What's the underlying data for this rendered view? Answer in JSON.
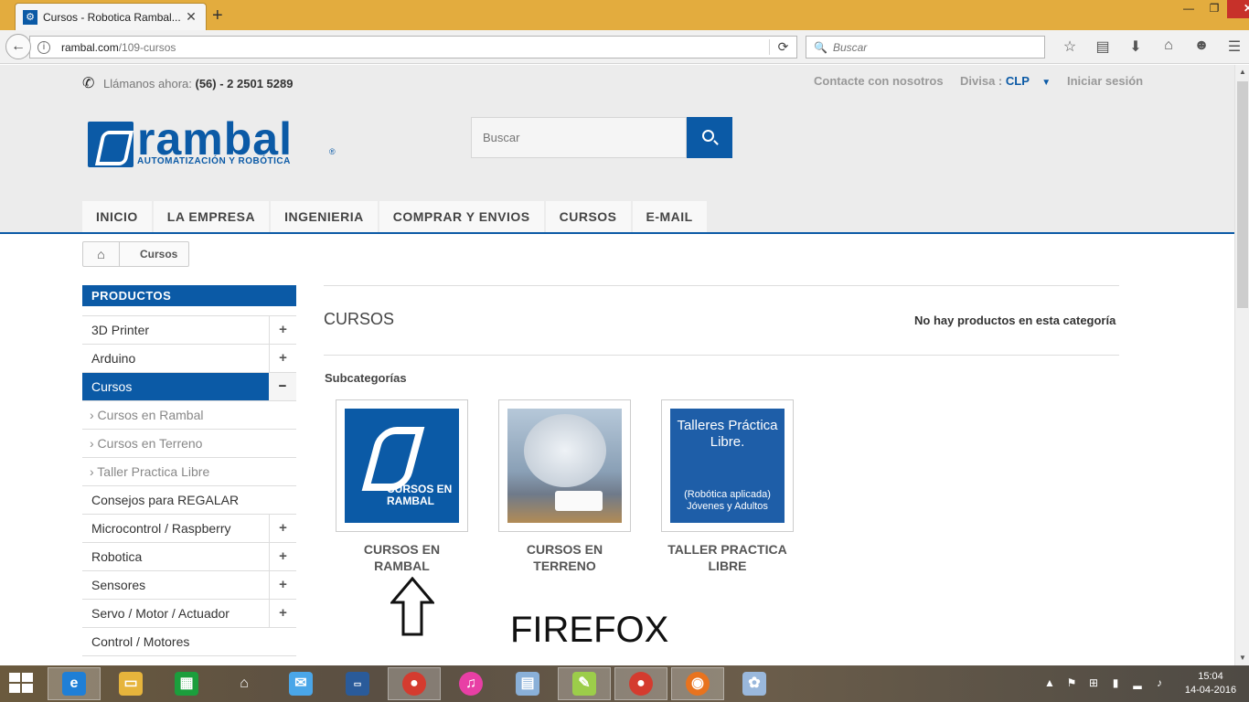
{
  "browser": {
    "tab_title": "Cursos - Robotica Rambal...",
    "tab_close": "✕",
    "new_tab": "+",
    "window_controls": {
      "minimize": "—",
      "maximize": "❐",
      "close": "✕"
    },
    "url_host": "rambal.com",
    "url_path": "/109-cursos",
    "search_placeholder": "Buscar",
    "toolbar_icons": [
      "star-icon",
      "reading-list-icon",
      "download-icon",
      "home-icon",
      "hello-icon",
      "menu-icon"
    ]
  },
  "header": {
    "call_label": "Llámanos ahora:",
    "phone": "(56) - 2 2501 5289",
    "contact_link": "Contacte con nosotros",
    "currency_label": "Divisa :",
    "currency_value": "CLP",
    "login_link": "Iniciar sesión",
    "logo_word": "rambal",
    "logo_sub": "AUTOMATIZACIÓN Y ROBÓTICA",
    "logo_reg": "®",
    "search_placeholder": "Buscar"
  },
  "menu": [
    "INICIO",
    "LA EMPRESA",
    "INGENIERIA",
    "COMPRAR Y ENVIOS",
    "CURSOS",
    "E-MAIL"
  ],
  "breadcrumb": {
    "current": "Cursos"
  },
  "sidebar": {
    "title": "PRODUCTOS",
    "items": [
      {
        "label": "3D Printer",
        "toggle": "+"
      },
      {
        "label": "Arduino",
        "toggle": "+"
      },
      {
        "label": "Cursos",
        "toggle": "−"
      },
      {
        "label": "› Cursos en Rambal",
        "toggle": ""
      },
      {
        "label": "› Cursos en Terreno",
        "toggle": ""
      },
      {
        "label": "› Taller Practica Libre",
        "toggle": ""
      },
      {
        "label": "Consejos para REGALAR",
        "toggle": ""
      },
      {
        "label": "Microcontrol / Raspberry",
        "toggle": "+"
      },
      {
        "label": "Robotica",
        "toggle": "+"
      },
      {
        "label": "Sensores",
        "toggle": "+"
      },
      {
        "label": "Servo / Motor / Actuador",
        "toggle": "+"
      },
      {
        "label": "Control / Motores",
        "toggle": ""
      }
    ]
  },
  "content": {
    "category_title": "CURSOS",
    "no_products": "No hay productos en esta categoría",
    "subcategories_label": "Subcategorías",
    "subcategories": [
      {
        "name": "CURSOS EN RAMBAL",
        "image_caption": "CURSOS EN RAMBAL"
      },
      {
        "name": "CURSOS EN TERRENO"
      },
      {
        "name": "TALLER PRACTICA LIBRE",
        "image_title": "Talleres Práctica Libre.",
        "image_sub": "(Robótica aplicada) Jóvenes y Adultos"
      }
    ],
    "annotation": "FIREFOX"
  },
  "taskbar": {
    "apps": [
      "internet-explorer-icon",
      "file-explorer-icon",
      "store-icon",
      "home-icon",
      "outlook-icon",
      "lenovo-icon",
      "chrome-icon",
      "winamp-icon",
      "network-icon",
      "notepad-icon",
      "chrome-icon",
      "firefox-icon",
      "paint-icon"
    ],
    "time": "15:04",
    "date": "14-04-2016"
  }
}
